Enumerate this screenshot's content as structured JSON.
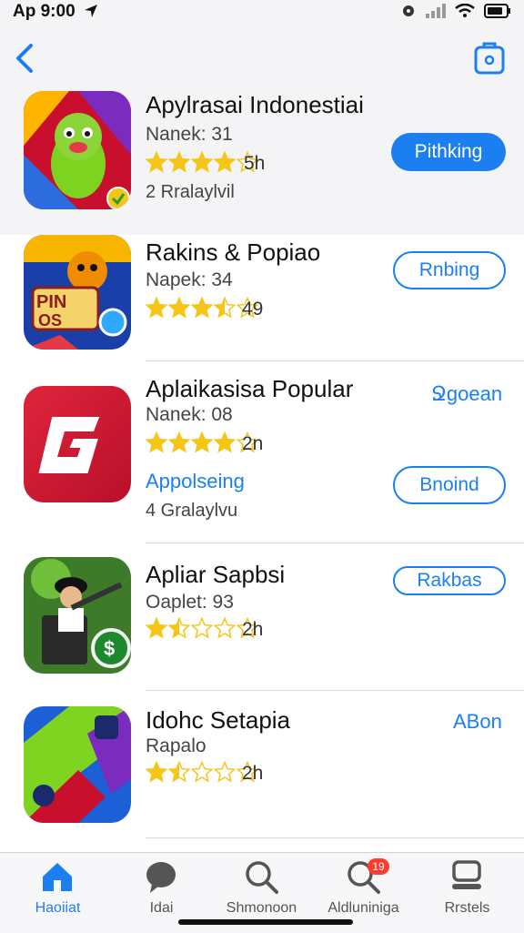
{
  "status_bar": {
    "time": "Ap 9:00"
  },
  "header": {
    "back_icon": "chevron-left-icon",
    "share_icon": "share-icon"
  },
  "apps": [
    {
      "title": "Apylrasai Indonestiai",
      "subtitle": "Nanek: 31",
      "rating": 4,
      "count": "5h",
      "extra": "2 Rralaylvil",
      "button": "Pithking"
    },
    {
      "title": "Rakins & Popiao",
      "subtitle": "Napek: 34",
      "rating": 3.5,
      "count": "49",
      "button": "Rnbing"
    },
    {
      "title": "Aplaikasisa Popular",
      "subtitle": "Nanek: 08",
      "rating": 4,
      "count": "2n",
      "link_top": "Ջgoean",
      "link_mid": "Appolseing",
      "extra": "4 Gralaylvu",
      "button": "Bnoind"
    },
    {
      "title": "Apliar Sapbsi",
      "subtitle": "Oaplet: 93",
      "rating": 1.5,
      "count": "2h",
      "button": "Rakbas"
    },
    {
      "title": "Idohc Setapia",
      "subtitle": "Rapalo",
      "rating": 1.5,
      "count": "2h",
      "link_top": "ABon"
    }
  ],
  "tabs": [
    {
      "label": "Haoiiat",
      "icon": "home-icon",
      "active": true
    },
    {
      "label": "Idai",
      "icon": "chat-icon",
      "active": false
    },
    {
      "label": "Shmonoon",
      "icon": "search-icon",
      "active": false
    },
    {
      "label": "Aldluniniga",
      "icon": "search-badge-icon",
      "active": false,
      "badge": "19"
    },
    {
      "label": "Rrstels",
      "icon": "profile-icon",
      "active": false
    }
  ],
  "colors": {
    "accent": "#1b7ff2",
    "star": "#f5c518",
    "badge": "#ff3b30"
  }
}
